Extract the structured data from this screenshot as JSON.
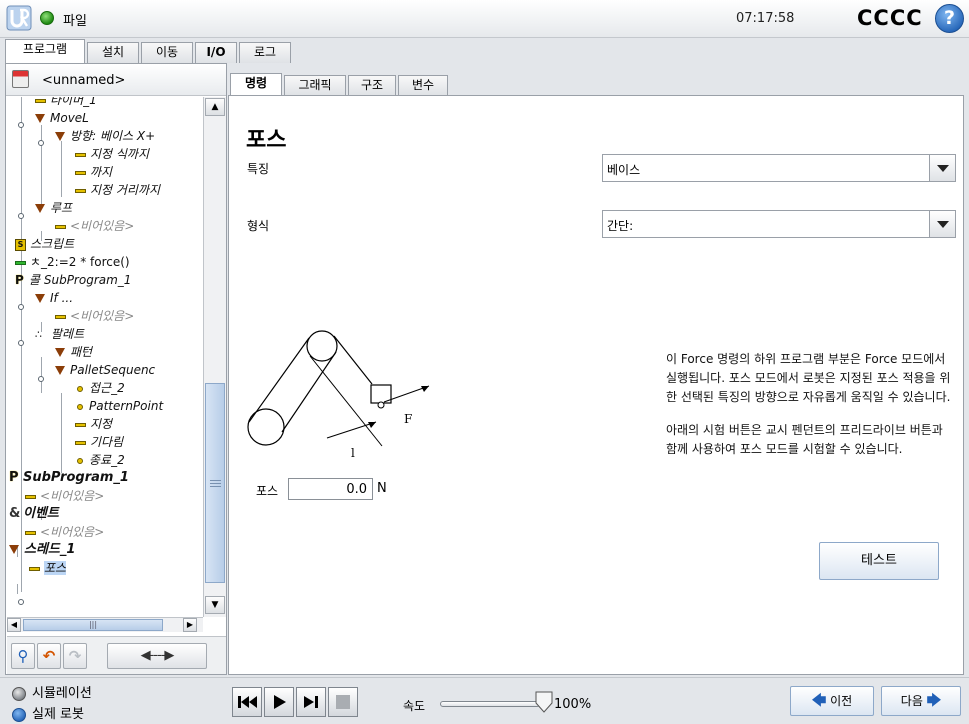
{
  "titlebar": {
    "file_menu": "파일",
    "clock": "07:17:58",
    "robot_name": "CCCC",
    "help": "?"
  },
  "main_tabs": [
    {
      "label": "프로그램",
      "active": true
    },
    {
      "label": "설치"
    },
    {
      "label": "이동"
    },
    {
      "label": "I/O"
    },
    {
      "label": "로그"
    }
  ],
  "program": {
    "name": "<unnamed>"
  },
  "tree": [
    {
      "label": "타이머_1",
      "icon": "dash"
    },
    {
      "label": "MoveL",
      "icon": "triangle"
    },
    {
      "label": "방향: 베이스 X+",
      "icon": "triangle"
    },
    {
      "label": "지정 식까지",
      "icon": "dash"
    },
    {
      "label": "까지",
      "icon": "dash"
    },
    {
      "label": "지정 거리까지",
      "icon": "dash"
    },
    {
      "label": "루프",
      "icon": "triangle"
    },
    {
      "label": "<비어있음>",
      "icon": "dash"
    },
    {
      "label": "스크립트",
      "icon": "script"
    },
    {
      "label": "ㅊ_2:=2 * force()",
      "icon": "assign"
    },
    {
      "label": "콜 SubProgram_1",
      "icon": "call"
    },
    {
      "label": "If ...",
      "icon": "triangle"
    },
    {
      "label": "<비어있음>",
      "icon": "dash"
    },
    {
      "label": "팔레트",
      "icon": "pallet"
    },
    {
      "label": "패턴",
      "icon": "triangle"
    },
    {
      "label": "PalletSequenc",
      "icon": "triangle"
    },
    {
      "label": "접근_2",
      "icon": "dot"
    },
    {
      "label": "PatternPoint",
      "icon": "dot"
    },
    {
      "label": "지정",
      "icon": "dash"
    },
    {
      "label": "기다림",
      "icon": "dash"
    },
    {
      "label": "종료_2",
      "icon": "dot"
    },
    {
      "label": "SubProgram_1",
      "icon": "call"
    },
    {
      "label": "<비어있음>",
      "icon": "dash"
    },
    {
      "label": "이벤트",
      "icon": "event"
    },
    {
      "label": "<비어있음>",
      "icon": "dash"
    },
    {
      "label": "스레드_1",
      "icon": "triangle"
    },
    {
      "label": "포스",
      "icon": "dash",
      "selected": true
    }
  ],
  "tree_tools": {
    "nav_arrows": "◀----▶"
  },
  "sub_tabs": [
    {
      "label": "명령",
      "active": true
    },
    {
      "label": "그래픽"
    },
    {
      "label": "구조"
    },
    {
      "label": "변수"
    }
  ],
  "command": {
    "title": "포스",
    "feature_label": "특징",
    "feature_value": "베이스",
    "type_label": "형식",
    "type_value": "간단:",
    "diagram_label_f": "F",
    "diagram_label_l": "l",
    "force_label": "포스",
    "force_value": "0.0",
    "force_unit": "N",
    "desc_1": "이 Force 명령의 하위 프로그램 부분은 Force 모드에서 실행됩니다. 포스 모드에서 로봇은 지정된 포스 적용을 위한 선택된 특징의 방향으로 자유롭게 움직일 수 있습니다.",
    "desc_2": "아래의 시험 버튼은 교시 펜던트의 프리드라이브 버튼과 함께 사용하여 포스 모드를 시험할 수 있습니다.",
    "test_button": "테스트"
  },
  "footer": {
    "simulation_label": "시뮬레이션",
    "real_robot_label": "실제 로봇",
    "speed_label": "속도",
    "speed_value": "100%",
    "speed_fraction": 1.0,
    "prev_label": "이전",
    "next_label": "다음"
  },
  "colors": {
    "accent": "#2565b8",
    "selection": "#bcd6f5",
    "node_icon": "#e5c100",
    "status_ok": "#1f8a12"
  }
}
